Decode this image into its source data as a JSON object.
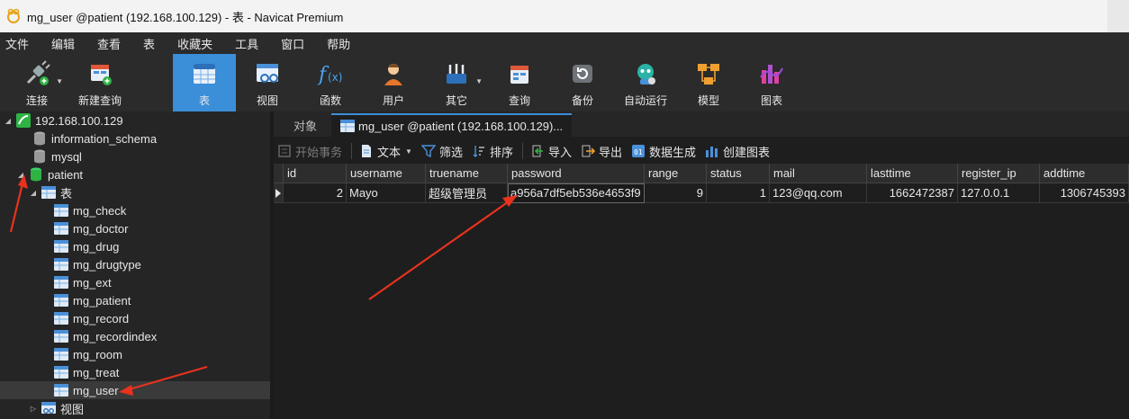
{
  "window": {
    "title": "mg_user @patient (192.168.100.129) - 表 - Navicat Premium"
  },
  "menu": [
    "文件",
    "编辑",
    "查看",
    "表",
    "收藏夹",
    "工具",
    "窗口",
    "帮助"
  ],
  "toolbar": [
    {
      "label": "连接",
      "icon": "connect-icon"
    },
    {
      "label": "新建查询",
      "icon": "new-query-icon"
    },
    {
      "label": "表",
      "icon": "table-icon"
    },
    {
      "label": "视图",
      "icon": "view-icon"
    },
    {
      "label": "函数",
      "icon": "function-icon"
    },
    {
      "label": "用户",
      "icon": "user-icon"
    },
    {
      "label": "其它",
      "icon": "other-icon"
    },
    {
      "label": "查询",
      "icon": "query-icon"
    },
    {
      "label": "备份",
      "icon": "backup-icon"
    },
    {
      "label": "自动运行",
      "icon": "automation-icon"
    },
    {
      "label": "模型",
      "icon": "model-icon"
    },
    {
      "label": "图表",
      "icon": "chart-icon"
    }
  ],
  "tree": {
    "connection": "192.168.100.129",
    "databases": [
      "information_schema",
      "mysql",
      "patient"
    ],
    "tables_label": "表",
    "tables": [
      "mg_check",
      "mg_doctor",
      "mg_drug",
      "mg_drugtype",
      "mg_ext",
      "mg_patient",
      "mg_record",
      "mg_recordindex",
      "mg_room",
      "mg_treat",
      "mg_user"
    ],
    "views_label": "视图"
  },
  "tabs": {
    "objects": "对象",
    "current": "mg_user @patient (192.168.100.129)..."
  },
  "data_toolbar": {
    "begin_transaction": "开始事务",
    "text": "文本",
    "filter": "筛选",
    "sort": "排序",
    "import": "导入",
    "export": "导出",
    "data_gen": "数据生成",
    "create_chart": "创建图表"
  },
  "grid": {
    "columns": [
      "id",
      "username",
      "truename",
      "password",
      "range",
      "status",
      "mail",
      "lasttime",
      "register_ip",
      "addtime"
    ],
    "row": {
      "id": "2",
      "username": "Mayo",
      "truename": "超级管理员",
      "password": "a956a7df5eb536e4653f9",
      "range": "9",
      "status": "1",
      "mail": "123@qq.com",
      "lasttime": "1662472387",
      "register_ip": "127.0.0.1",
      "addtime": "1306745393"
    }
  },
  "colors": {
    "accent": "#3b8ed8",
    "annotation": "#e8321e"
  }
}
